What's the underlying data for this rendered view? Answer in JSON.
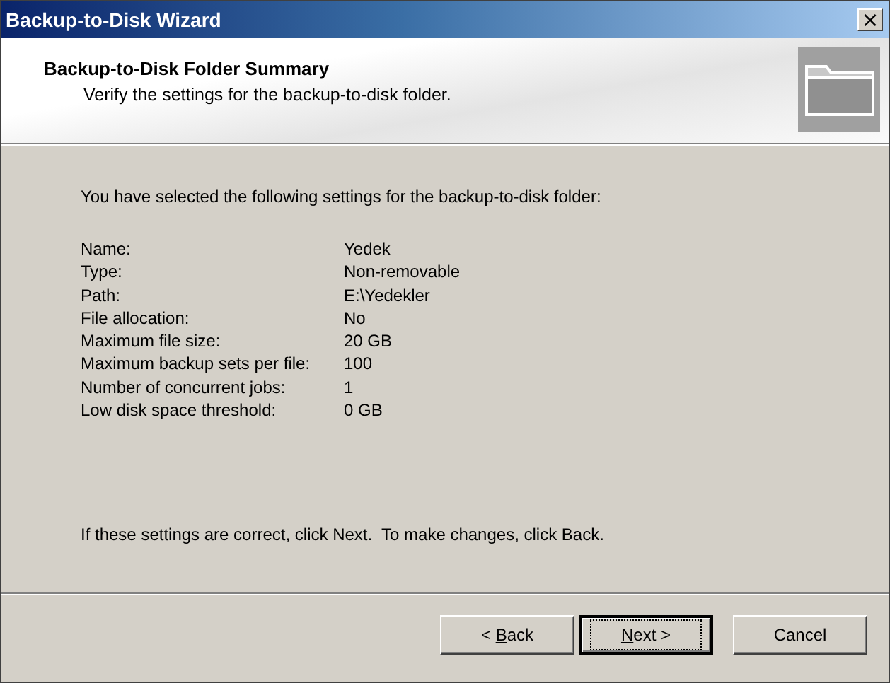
{
  "window": {
    "title": "Backup-to-Disk Wizard",
    "close": "×"
  },
  "header": {
    "title": "Backup-to-Disk Folder Summary",
    "subtitle": "Verify the settings for the backup-to-disk folder."
  },
  "intro": "You have selected the following settings for the backup-to-disk folder:",
  "settings": [
    {
      "label": "Name:",
      "value": "Yedek"
    },
    {
      "label": "Type:",
      "value": "Non-removable"
    },
    {
      "label": "Path:",
      "value": "E:\\Yedekler"
    },
    {
      "label": "File allocation:",
      "value": "No"
    },
    {
      "label": "Maximum file size:",
      "value": "20 GB"
    },
    {
      "label": "Maximum backup sets per file:",
      "value": "100"
    },
    {
      "label": "Number of concurrent jobs:",
      "value": "1"
    },
    {
      "label": "Low disk space threshold:",
      "value": "0 GB"
    }
  ],
  "footer_note": "If these settings are correct, click Next.  To make changes, click Back.",
  "buttons": [
    {
      "label_start": "< ",
      "access_key": "B",
      "label_end": "ack",
      "default": false
    },
    {
      "access_key": "N",
      "label_end": "ext >",
      "default": true
    },
    {
      "label": "Cancel",
      "default": false
    }
  ]
}
